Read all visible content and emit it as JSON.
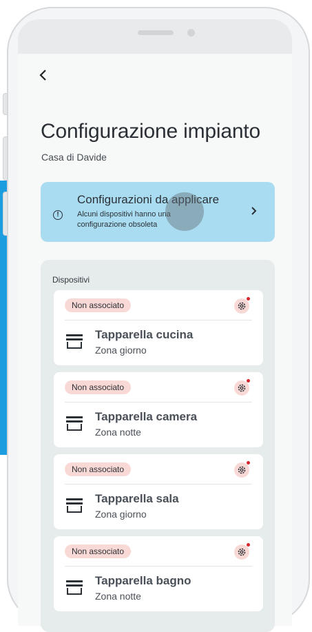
{
  "header": {
    "title": "Configurazione impianto",
    "subtitle": "Casa di Davide"
  },
  "banner": {
    "title": "Configurazioni da applicare",
    "text": "Alcuni dispositivi hanno una configurazione obsoleta"
  },
  "devices": {
    "section_label": "Dispositivi",
    "items": [
      {
        "status": "Non associato",
        "name": "Tapparella cucina",
        "zone": "Zona giorno"
      },
      {
        "status": "Non associato",
        "name": "Tapparella camera",
        "zone": "Zona notte"
      },
      {
        "status": "Non associato",
        "name": "Tapparella sala",
        "zone": "Zona giorno"
      },
      {
        "status": "Non associato",
        "name": "Tapparella bagno",
        "zone": "Zona notte"
      }
    ]
  },
  "icons": {
    "back": "chevron-left-icon",
    "info": "info-circle-icon",
    "banner_arrow": "chevron-right-icon",
    "settings": "gear-icon",
    "device": "roller-shutter-icon"
  },
  "colors": {
    "banner_bg": "#a9dcf1",
    "badge_bg": "#f9d9d6",
    "notification_dot": "#d8262c",
    "panel_bg": "#e6ebeb"
  }
}
